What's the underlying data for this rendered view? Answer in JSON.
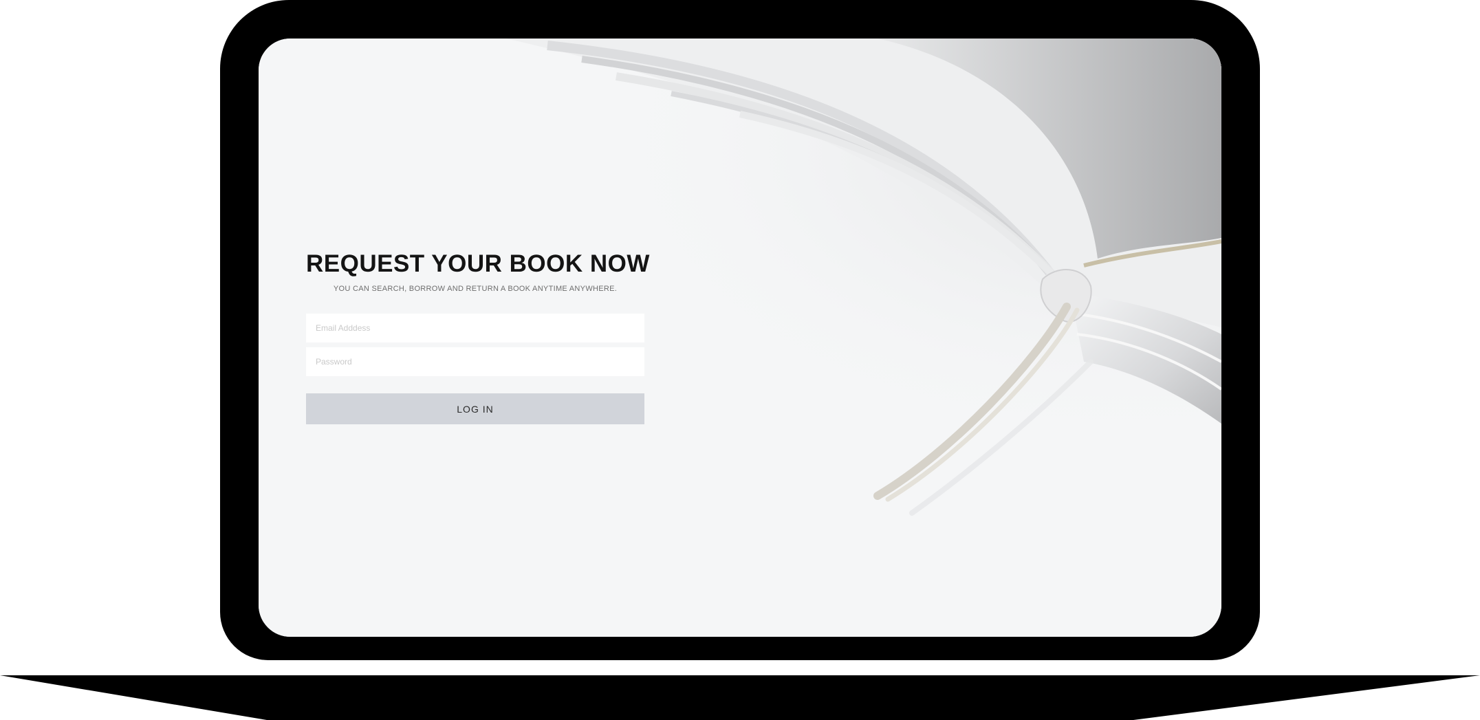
{
  "hero": {
    "title": "REQUEST YOUR BOOK NOW",
    "subtitle": "YOU CAN SEARCH, BORROW AND RETURN A BOOK ANYTIME ANYWHERE."
  },
  "form": {
    "email_placeholder": "Email Adddess",
    "password_placeholder": "Password",
    "login_label": "LOG IN"
  },
  "colors": {
    "bezel": "#000000",
    "button_bg": "#d1d4da",
    "title": "#141414",
    "subtitle": "#6d6d6d"
  },
  "icons": {
    "background_image": "open-book-with-ribbon-bookmark"
  }
}
